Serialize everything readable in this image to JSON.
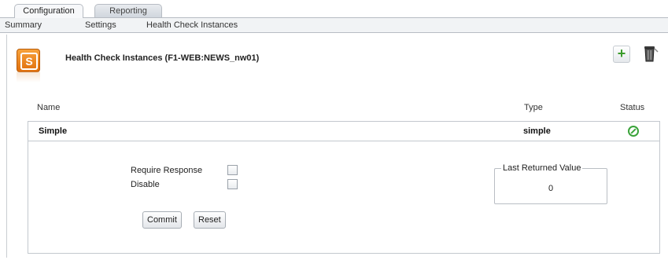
{
  "tabs": [
    {
      "label": "Configuration",
      "active": true
    },
    {
      "label": "Reporting",
      "active": false
    }
  ],
  "subnav": [
    "Summary",
    "Settings",
    "Health Check Instances"
  ],
  "header": {
    "title": "Health Check Instances (F1-WEB:NEWS_nw01)",
    "logo_letter": "S"
  },
  "table": {
    "columns": [
      "Name",
      "Type",
      "Status"
    ],
    "rows": [
      {
        "name": "Simple",
        "type": "simple",
        "status": "ok"
      }
    ]
  },
  "detail": {
    "require_response_label": "Require Response",
    "disable_label": "Disable",
    "commit_label": "Commit",
    "reset_label": "Reset",
    "last_returned_legend": "Last Returned Value",
    "last_returned_value": "0"
  },
  "icons": {
    "add": "plus-icon",
    "delete": "trash-icon",
    "status": "ok-circle-icon"
  },
  "colors": {
    "accent_orange": "#e06f0d",
    "status_green": "#3aa33a",
    "add_green": "#3a9b2a"
  }
}
